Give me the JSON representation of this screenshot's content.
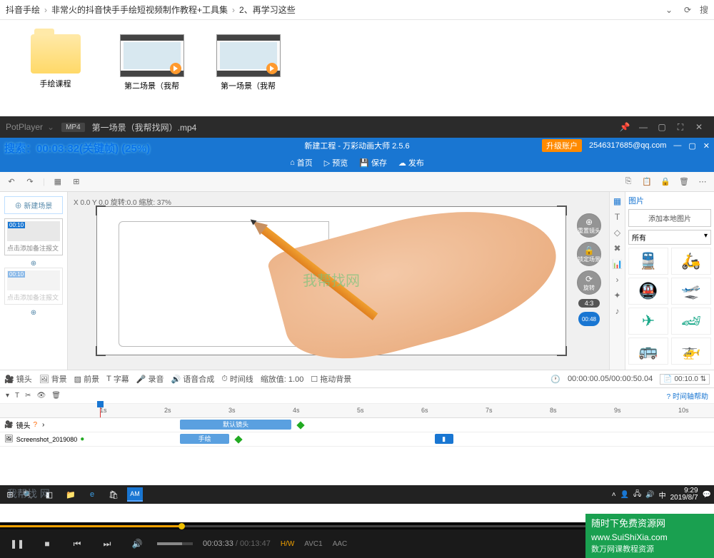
{
  "explorer": {
    "crumbs": [
      "抖音手绘",
      "非常火的抖音快手手绘短视频制作教程+工具集",
      "2、再学习这些"
    ],
    "search_hint": "搜",
    "items": [
      {
        "label": "手绘课程",
        "type": "folder"
      },
      {
        "label": "第二场景（我帮",
        "type": "video"
      },
      {
        "label": "第一场景（我帮",
        "type": "video"
      }
    ]
  },
  "potplayer": {
    "app": "PotPlayer",
    "badge": "MP4",
    "file": "第一场景（我帮找网）.mp4",
    "overlay": "搜索：00:03:32(关键帧) (25%)",
    "time_cur": "00:03:33",
    "time_tot": "00:13:47",
    "hw": "H/W",
    "vcodec": "AVC1",
    "acodec": "AAC"
  },
  "anim": {
    "title": "新建工程 - 万彩动画大师 2.5.6",
    "upgrade": "升级账户",
    "account": "2546317685@qq.com",
    "menu": [
      "首页",
      "预览",
      "保存",
      "发布"
    ],
    "scene_btn": "新建场景",
    "scene_time": "00:10",
    "scene_caption": "点击添加备注报文",
    "canvas_info": "X 0.0 Y 0.0 旋转:0.0 缩放: 37%",
    "watermark": "我帮找网",
    "controls": {
      "reset": "重置镜头",
      "lock": "锁定场景",
      "rotate": "旋转",
      "ratio": "4:3",
      "time": "00:48"
    },
    "images": {
      "title": "图片",
      "add": "添加本地图片",
      "filter": "所有"
    },
    "tabs": {
      "items": [
        "镜头",
        "背景",
        "前景",
        "字幕",
        "录音",
        "语音合成",
        "时间线",
        "缩放值: 1.00",
        "拖动背景"
      ],
      "time_right1": "00:00:00.05/00:00:50.04",
      "time_box": "00:10.0"
    },
    "timeline": {
      "help": "时间轴帮助",
      "ticks": [
        "1s",
        "2s",
        "3s",
        "4s",
        "5s",
        "6s",
        "7s",
        "8s",
        "9s",
        "10s"
      ],
      "rows": [
        {
          "label": "镜头",
          "clip": "默认镜头",
          "color": "#5aa0e0",
          "start": 14,
          "width": 18
        },
        {
          "label": "Screenshot_2019080",
          "clip": "手绘",
          "color": "#5aa0e0",
          "start": 14,
          "width": 8,
          "marker_at": 55,
          "marker_color": "#1976d2"
        }
      ]
    }
  },
  "taskbar": {
    "datetime": {
      "time": "9:29",
      "date": "2019/8/7"
    },
    "left_wm": "我帮找 网"
  },
  "watermark": {
    "l1": "随时下免费资源网",
    "l2": "www.SuiShiXia.com",
    "l3": "数万网课教程资源"
  }
}
